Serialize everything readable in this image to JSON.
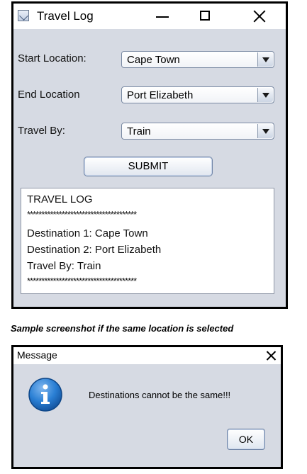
{
  "window": {
    "title": "Travel Log"
  },
  "form": {
    "start_label": "Start Location:",
    "start_value": "Cape Town",
    "end_label": "End Location",
    "end_value": "Port Elizabeth",
    "travel_label": "Travel By:",
    "travel_value": "Train",
    "submit_label": "SUBMIT"
  },
  "output": {
    "lines": [
      "TRAVEL LOG",
      "**************************************",
      "Destination 1: Cape Town",
      "Destination 2: Port Elizabeth",
      "Travel By: Train",
      "**************************************"
    ]
  },
  "caption": "Sample screenshot if the same location is selected",
  "dialog": {
    "title": "Message",
    "message": "Destinations cannot be the same!!!",
    "ok_label": "OK",
    "icon": "info-icon"
  },
  "colors": {
    "window_bg": "#d6dae3",
    "info_blue": "#1f73c9"
  }
}
